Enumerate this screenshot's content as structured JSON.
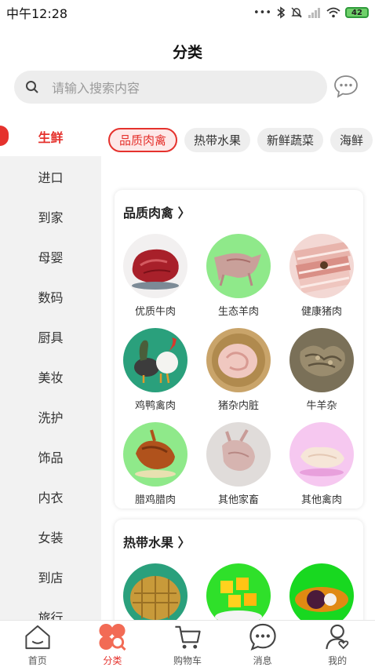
{
  "status_bar": {
    "time": "中午12:28",
    "battery": "42"
  },
  "header": {
    "title": "分类"
  },
  "search": {
    "placeholder": "请输入搜索内容"
  },
  "sidebar": {
    "items": [
      {
        "label": "生鲜",
        "active": true
      },
      {
        "label": "进口"
      },
      {
        "label": "到家"
      },
      {
        "label": "母婴"
      },
      {
        "label": "数码"
      },
      {
        "label": "厨具"
      },
      {
        "label": "美妆"
      },
      {
        "label": "洗护"
      },
      {
        "label": "饰品"
      },
      {
        "label": "内衣"
      },
      {
        "label": "女装"
      },
      {
        "label": "到店"
      },
      {
        "label": "旅行"
      }
    ]
  },
  "chips": [
    "品质肉禽",
    "热带水果",
    "新鲜蔬菜",
    "海鲜"
  ],
  "sections": [
    {
      "title": "品质肉禽 〉",
      "items": [
        {
          "label": "优质牛肉"
        },
        {
          "label": "生态羊肉"
        },
        {
          "label": "健康猪肉"
        },
        {
          "label": "鸡鸭禽肉"
        },
        {
          "label": "猪杂内脏"
        },
        {
          "label": "牛羊杂"
        },
        {
          "label": "腊鸡腊肉"
        },
        {
          "label": "其他家畜"
        },
        {
          "label": "其他禽肉"
        }
      ]
    },
    {
      "title": "热带水果 〉"
    }
  ],
  "tabbar": {
    "items": [
      {
        "label": "首页"
      },
      {
        "label": "分类",
        "active": true
      },
      {
        "label": "购物车"
      },
      {
        "label": "消息"
      },
      {
        "label": "我的"
      }
    ]
  },
  "colors": {
    "accent": "#e5322d",
    "sidebar_bg": "#f2f2f2"
  }
}
